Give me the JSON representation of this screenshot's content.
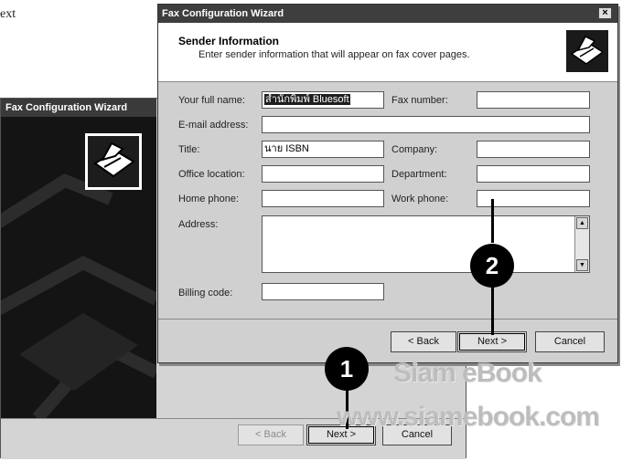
{
  "stray_text": "ext",
  "stray_text_bottom": "้",
  "back_window": {
    "title": "Fax Configuration Wizard",
    "back_label": "< Back",
    "next_label": "Next >",
    "cancel_label": "Cancel"
  },
  "front_window": {
    "title": "Fax Configuration Wizard",
    "close_label": "×",
    "header_title": "Sender Information",
    "header_subtitle": "Enter sender information that will appear on fax cover pages.",
    "fields": {
      "full_name": {
        "label": "Your full name:",
        "value": "สำนักพิมพ์ Bluesoft"
      },
      "fax_number": {
        "label": "Fax number:",
        "value": ""
      },
      "email": {
        "label": "E-mail address:",
        "value": ""
      },
      "title": {
        "label": "Title:",
        "value": "นาย ISBN"
      },
      "company": {
        "label": "Company:",
        "value": ""
      },
      "office_location": {
        "label": "Office location:",
        "value": ""
      },
      "department": {
        "label": "Department:",
        "value": ""
      },
      "home_phone": {
        "label": "Home phone:",
        "value": ""
      },
      "work_phone": {
        "label": "Work phone:",
        "value": ""
      },
      "address": {
        "label": "Address:",
        "value": ""
      },
      "billing_code": {
        "label": "Billing code:",
        "value": ""
      }
    },
    "back_label": "< Back",
    "next_label": "Next >",
    "cancel_label": "Cancel"
  },
  "callouts": {
    "one": "1",
    "two": "2"
  },
  "watermark": {
    "line1": "Siam eBook",
    "line2": "www.siamebook.com"
  },
  "icons": {
    "wizard": "fax-machine-icon",
    "header": "fax-machine-icon"
  }
}
